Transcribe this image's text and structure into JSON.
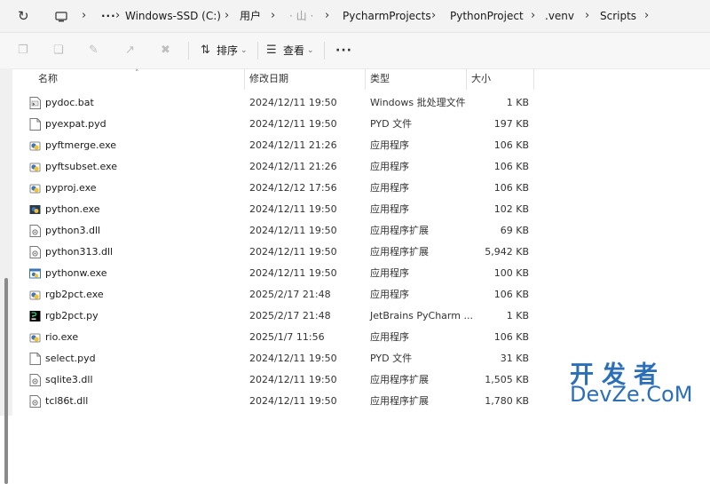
{
  "address_bar": {
    "segments": [
      "Windows-SSD (C:)",
      "用户",
      "· 山 ·",
      "PycharmProjects",
      "PythonProject",
      ".venv",
      "Scripts"
    ],
    "more": "···"
  },
  "toolbar": {
    "sort_label": "排序",
    "view_label": "查看",
    "more": "···"
  },
  "columns": {
    "name": "名称",
    "date": "修改日期",
    "type": "类型",
    "size": "大小"
  },
  "files": [
    {
      "name": "pydoc.bat",
      "date": "2024/12/11 19:50",
      "type": "Windows 批处理文件",
      "size": "1 KB",
      "icon": "batch-file-icon"
    },
    {
      "name": "pyexpat.pyd",
      "date": "2024/12/11 19:50",
      "type": "PYD 文件",
      "size": "197 KB",
      "icon": "blank-file-icon"
    },
    {
      "name": "pyftmerge.exe",
      "date": "2024/12/11 21:26",
      "type": "应用程序",
      "size": "106 KB",
      "icon": "python-exe-icon"
    },
    {
      "name": "pyftsubset.exe",
      "date": "2024/12/11 21:26",
      "type": "应用程序",
      "size": "106 KB",
      "icon": "python-exe-icon"
    },
    {
      "name": "pyproj.exe",
      "date": "2024/12/12 17:56",
      "type": "应用程序",
      "size": "106 KB",
      "icon": "python-exe-icon"
    },
    {
      "name": "python.exe",
      "date": "2024/12/11 19:50",
      "type": "应用程序",
      "size": "102 KB",
      "icon": "python-console-icon"
    },
    {
      "name": "python3.dll",
      "date": "2024/12/11 19:50",
      "type": "应用程序扩展",
      "size": "69 KB",
      "icon": "dll-file-icon"
    },
    {
      "name": "python313.dll",
      "date": "2024/12/11 19:50",
      "type": "应用程序扩展",
      "size": "5,942 KB",
      "icon": "dll-file-icon"
    },
    {
      "name": "pythonw.exe",
      "date": "2024/12/11 19:50",
      "type": "应用程序",
      "size": "100 KB",
      "icon": "python-window-icon"
    },
    {
      "name": "rgb2pct.exe",
      "date": "2025/2/17 21:48",
      "type": "应用程序",
      "size": "106 KB",
      "icon": "python-exe-icon"
    },
    {
      "name": "rgb2pct.py",
      "date": "2025/2/17 21:48",
      "type": "JetBrains PyCharm ...",
      "size": "1 KB",
      "icon": "pycharm-file-icon"
    },
    {
      "name": "rio.exe",
      "date": "2025/1/7 11:56",
      "type": "应用程序",
      "size": "106 KB",
      "icon": "python-exe-icon"
    },
    {
      "name": "select.pyd",
      "date": "2024/12/11 19:50",
      "type": "PYD 文件",
      "size": "31 KB",
      "icon": "blank-file-icon"
    },
    {
      "name": "sqlite3.dll",
      "date": "2024/12/11 19:50",
      "type": "应用程序扩展",
      "size": "1,505 KB",
      "icon": "dll-file-icon"
    },
    {
      "name": "tcl86t.dll",
      "date": "2024/12/11 19:50",
      "type": "应用程序扩展",
      "size": "1,780 KB",
      "icon": "dll-file-icon"
    }
  ],
  "watermark": {
    "line1": "开发者",
    "line2": "DevZe.CoM"
  }
}
